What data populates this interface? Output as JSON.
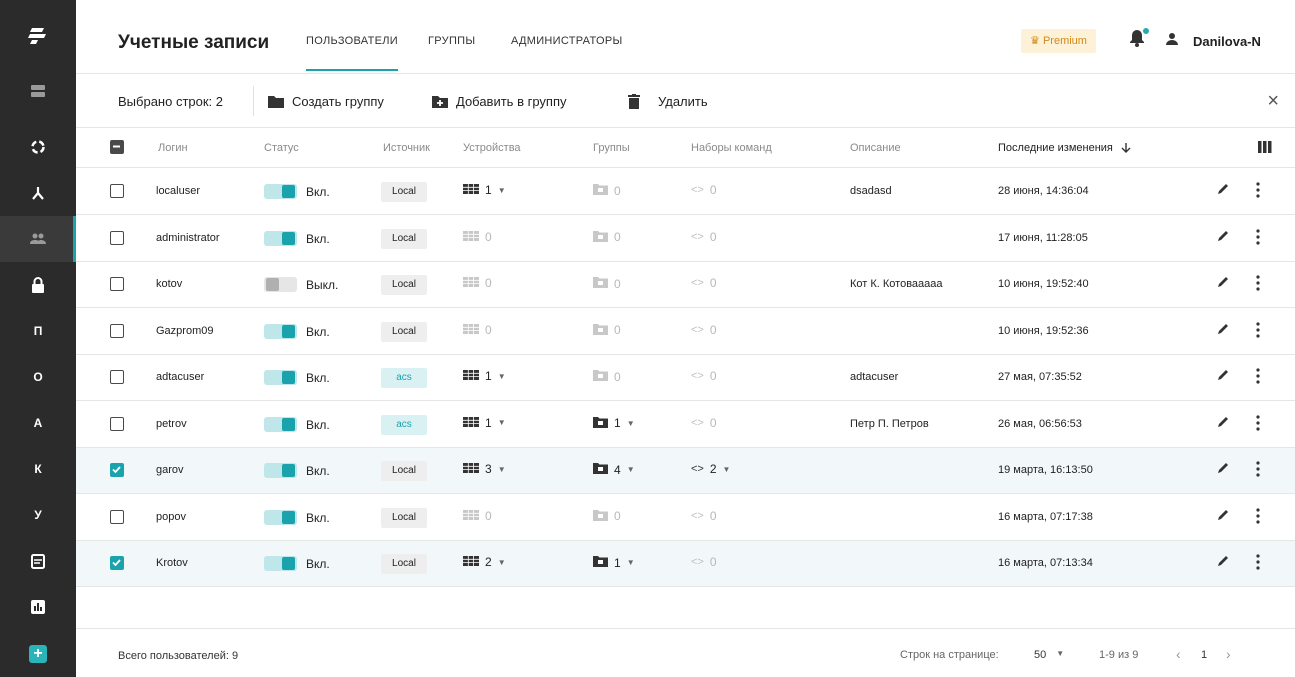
{
  "sidebar": {
    "letters": [
      "П",
      "О",
      "А",
      "К",
      "У"
    ]
  },
  "header": {
    "title": "Учетные записи",
    "tabs": [
      {
        "label": "ПОЛЬЗОВАТЕЛИ",
        "active": true
      },
      {
        "label": "ГРУППЫ",
        "active": false
      },
      {
        "label": "АДМИНИСТРАТОРЫ",
        "active": false
      }
    ],
    "premium_label": "♛ Premium",
    "user_name": "Danilova-N"
  },
  "actionbar": {
    "selected_label": "Выбрано строк: 2",
    "create_group": "Создать группу",
    "add_to_group": "Добавить в группу",
    "delete": "Удалить",
    "close": "×"
  },
  "table": {
    "columns": {
      "login": "Логин",
      "status": "Статус",
      "source": "Источник",
      "devices": "Устройства",
      "groups": "Группы",
      "command_sets": "Наборы команд",
      "description": "Описание",
      "last_modified": "Последние изменения"
    },
    "rows": [
      {
        "login": "localuser",
        "status": "Вкл.",
        "on": true,
        "source": "Local",
        "devices": "1",
        "devices_dd": true,
        "groups": "0",
        "groups_dd": false,
        "cmds": "0",
        "cmds_dd": false,
        "description": "dsadasd",
        "modified": "28 июня, 14:36:04",
        "selected": false
      },
      {
        "login": "administrator",
        "status": "Вкл.",
        "on": true,
        "source": "Local",
        "devices": "0",
        "devices_dd": false,
        "groups": "0",
        "groups_dd": false,
        "cmds": "0",
        "cmds_dd": false,
        "description": "",
        "modified": "17 июня, 11:28:05",
        "selected": false
      },
      {
        "login": "kotov",
        "status": "Выкл.",
        "on": false,
        "source": "Local",
        "devices": "0",
        "devices_dd": false,
        "groups": "0",
        "groups_dd": false,
        "cmds": "0",
        "cmds_dd": false,
        "description": "Кот К. Котоваaaaa",
        "modified": "10 июня, 19:52:40",
        "selected": false
      },
      {
        "login": "Gazprom09",
        "status": "Вкл.",
        "on": true,
        "source": "Local",
        "devices": "0",
        "devices_dd": false,
        "groups": "0",
        "groups_dd": false,
        "cmds": "0",
        "cmds_dd": false,
        "description": "",
        "modified": "10 июня, 19:52:36",
        "selected": false
      },
      {
        "login": "adtacuser",
        "status": "Вкл.",
        "on": true,
        "source": "acs",
        "devices": "1",
        "devices_dd": true,
        "groups": "0",
        "groups_dd": false,
        "cmds": "0",
        "cmds_dd": false,
        "description": "adtacuser",
        "modified": "27 мая, 07:35:52",
        "selected": false
      },
      {
        "login": "petrov",
        "status": "Вкл.",
        "on": true,
        "source": "acs",
        "devices": "1",
        "devices_dd": true,
        "groups": "1",
        "groups_dd": true,
        "cmds": "0",
        "cmds_dd": false,
        "description": "Петр П. Петров",
        "modified": "26 мая, 06:56:53",
        "selected": false
      },
      {
        "login": "garov",
        "status": "Вкл.",
        "on": true,
        "source": "Local",
        "devices": "3",
        "devices_dd": true,
        "groups": "4",
        "groups_dd": true,
        "cmds": "2",
        "cmds_dd": true,
        "description": "",
        "modified": "19 марта, 16:13:50",
        "selected": true
      },
      {
        "login": "popov",
        "status": "Вкл.",
        "on": true,
        "source": "Local",
        "devices": "0",
        "devices_dd": false,
        "groups": "0",
        "groups_dd": false,
        "cmds": "0",
        "cmds_dd": false,
        "description": "",
        "modified": "16 марта, 07:17:38",
        "selected": false
      },
      {
        "login": "Krotov",
        "status": "Вкл.",
        "on": true,
        "source": "Local",
        "devices": "2",
        "devices_dd": true,
        "groups": "1",
        "groups_dd": true,
        "cmds": "0",
        "cmds_dd": false,
        "description": "",
        "modified": "16 марта, 07:13:34",
        "selected": true
      }
    ]
  },
  "footer": {
    "total": "Всего пользователей: 9",
    "rows_per_page_label": "Строк на странице:",
    "rows_per_page": "50",
    "range": "1-9 из 9",
    "page": "1"
  },
  "colors": {
    "accent": "#1aa3ad",
    "sidebar": "#2b2b2b",
    "premium_bg": "#fdf1d8",
    "premium_text": "#d08a1a"
  }
}
